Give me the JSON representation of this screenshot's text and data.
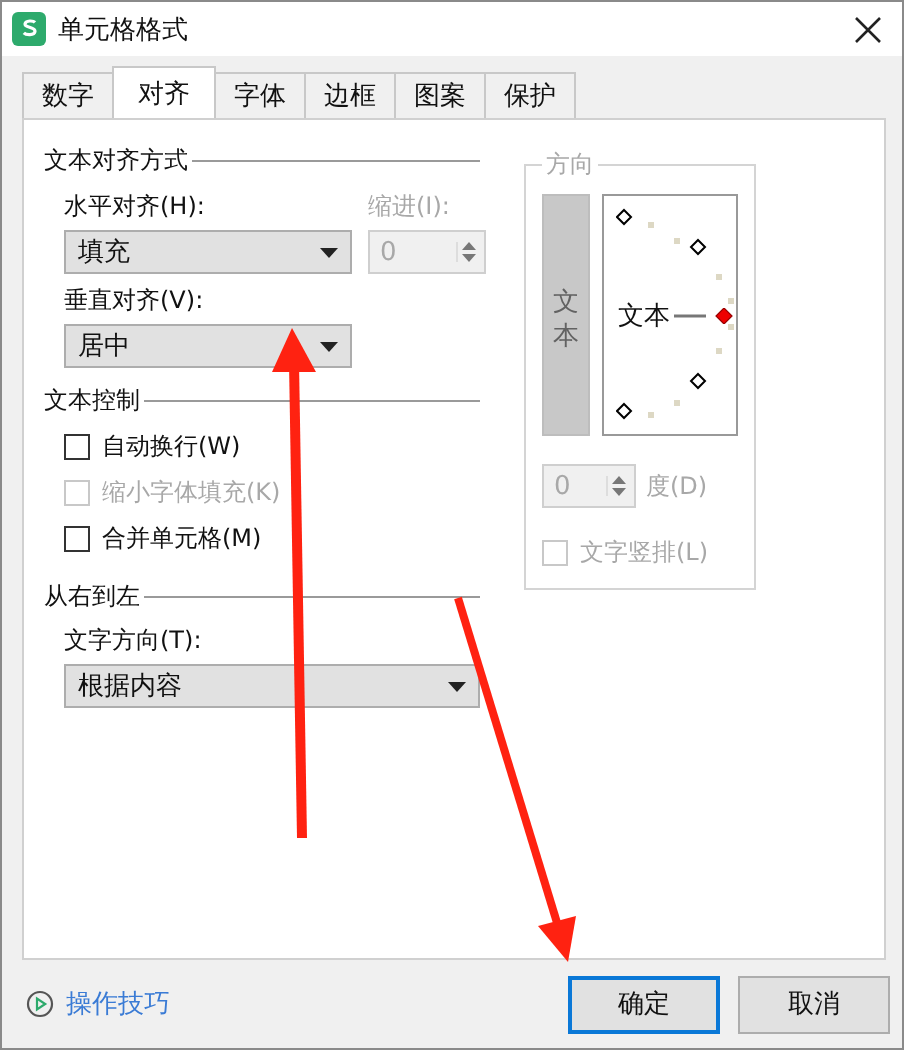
{
  "window": {
    "title": "单元格格式"
  },
  "tabs": [
    {
      "label": "数字",
      "selected": false
    },
    {
      "label": "对齐",
      "selected": true
    },
    {
      "label": "字体",
      "selected": false
    },
    {
      "label": "边框",
      "selected": false
    },
    {
      "label": "图案",
      "selected": false
    },
    {
      "label": "保护",
      "selected": false
    }
  ],
  "alignment": {
    "title": "文本对齐方式",
    "horizontal": {
      "label": "水平对齐(H):",
      "value": "填充"
    },
    "indent": {
      "label": "缩进(I):",
      "value": "0",
      "disabled": true
    },
    "vertical": {
      "label": "垂直对齐(V):",
      "value": "居中"
    }
  },
  "text_control": {
    "title": "文本控制",
    "options": [
      {
        "label": "自动换行(W)",
        "checked": false,
        "disabled": false
      },
      {
        "label": "缩小字体填充(K)",
        "checked": false,
        "disabled": true
      },
      {
        "label": "合并单元格(M)",
        "checked": false,
        "disabled": false
      }
    ]
  },
  "right_to_left": {
    "title": "从右到左",
    "direction": {
      "label": "文字方向(T):",
      "value": "根据内容"
    }
  },
  "orientation": {
    "title": "方向",
    "vertical_text": "文本",
    "dial_text": "文本",
    "degrees": {
      "value": "0",
      "label": "度(D)",
      "disabled": true
    },
    "stack": {
      "label": "文字竖排(L)",
      "checked": false,
      "disabled": true
    }
  },
  "footer": {
    "tips": "操作技巧",
    "buttons": [
      {
        "label": "确定",
        "default": true
      },
      {
        "label": "取消",
        "default": false
      }
    ]
  }
}
